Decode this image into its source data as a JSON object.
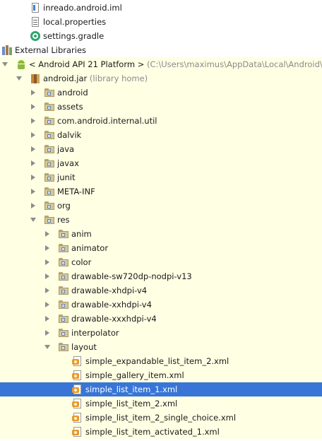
{
  "tree": {
    "rows": [
      {
        "label": "inreado.android.iml",
        "hint": "",
        "icon": "iml-file-icon",
        "arrow": "none",
        "depth": 2,
        "name": "tree-node-inreado-android-iml"
      },
      {
        "label": "local.properties",
        "hint": "",
        "icon": "properties-file-icon",
        "arrow": "none",
        "depth": 2,
        "name": "tree-node-local-properties"
      },
      {
        "label": "settings.gradle",
        "hint": "",
        "icon": "gradle-file-icon",
        "arrow": "none",
        "depth": 2,
        "name": "tree-node-settings-gradle"
      },
      {
        "label": "External Libraries",
        "hint": "",
        "icon": "external-libraries-icon",
        "arrow": "expanded",
        "depth": 0,
        "name": "tree-node-external-libraries"
      },
      {
        "label": "< Android API 21 Platform >",
        "hint": " (C:\\Users\\maximus\\AppData\\Local\\Android\\sdk)",
        "icon": "android-platform-icon",
        "arrow": "expanded",
        "depth": 1,
        "name": "tree-node-android-api-21-platform"
      },
      {
        "label": "android.jar",
        "hint": " (library home)",
        "icon": "jar-icon",
        "arrow": "expanded",
        "depth": 2,
        "name": "tree-node-android-jar"
      },
      {
        "label": "android",
        "hint": "",
        "icon": "package-folder-icon",
        "arrow": "collapsed",
        "depth": 3,
        "name": "tree-node-android"
      },
      {
        "label": "assets",
        "hint": "",
        "icon": "package-folder-icon",
        "arrow": "collapsed",
        "depth": 3,
        "name": "tree-node-assets"
      },
      {
        "label": "com.android.internal.util",
        "hint": "",
        "icon": "package-folder-icon",
        "arrow": "collapsed",
        "depth": 3,
        "name": "tree-node-com-android-internal-util"
      },
      {
        "label": "dalvik",
        "hint": "",
        "icon": "package-folder-icon",
        "arrow": "collapsed",
        "depth": 3,
        "name": "tree-node-dalvik"
      },
      {
        "label": "java",
        "hint": "",
        "icon": "package-folder-icon",
        "arrow": "collapsed",
        "depth": 3,
        "name": "tree-node-java"
      },
      {
        "label": "javax",
        "hint": "",
        "icon": "package-folder-icon",
        "arrow": "collapsed",
        "depth": 3,
        "name": "tree-node-javax"
      },
      {
        "label": "junit",
        "hint": "",
        "icon": "package-folder-icon",
        "arrow": "collapsed",
        "depth": 3,
        "name": "tree-node-junit"
      },
      {
        "label": "META-INF",
        "hint": "",
        "icon": "package-folder-icon",
        "arrow": "collapsed",
        "depth": 3,
        "name": "tree-node-meta-inf"
      },
      {
        "label": "org",
        "hint": "",
        "icon": "package-folder-icon",
        "arrow": "collapsed",
        "depth": 3,
        "name": "tree-node-org"
      },
      {
        "label": "res",
        "hint": "",
        "icon": "package-folder-icon",
        "arrow": "expanded",
        "depth": 3,
        "name": "tree-node-res"
      },
      {
        "label": "anim",
        "hint": "",
        "icon": "package-folder-icon",
        "arrow": "collapsed",
        "depth": 4,
        "name": "tree-node-anim"
      },
      {
        "label": "animator",
        "hint": "",
        "icon": "package-folder-icon",
        "arrow": "collapsed",
        "depth": 4,
        "name": "tree-node-animator"
      },
      {
        "label": "color",
        "hint": "",
        "icon": "package-folder-icon",
        "arrow": "collapsed",
        "depth": 4,
        "name": "tree-node-color"
      },
      {
        "label": "drawable-sw720dp-nodpi-v13",
        "hint": "",
        "icon": "package-folder-icon",
        "arrow": "collapsed",
        "depth": 4,
        "name": "tree-node-drawable-sw720dp-nodpi-v13"
      },
      {
        "label": "drawable-xhdpi-v4",
        "hint": "",
        "icon": "package-folder-icon",
        "arrow": "collapsed",
        "depth": 4,
        "name": "tree-node-drawable-xhdpi-v4"
      },
      {
        "label": "drawable-xxhdpi-v4",
        "hint": "",
        "icon": "package-folder-icon",
        "arrow": "collapsed",
        "depth": 4,
        "name": "tree-node-drawable-xxhdpi-v4"
      },
      {
        "label": "drawable-xxxhdpi-v4",
        "hint": "",
        "icon": "package-folder-icon",
        "arrow": "collapsed",
        "depth": 4,
        "name": "tree-node-drawable-xxxhdpi-v4"
      },
      {
        "label": "interpolator",
        "hint": "",
        "icon": "package-folder-icon",
        "arrow": "collapsed",
        "depth": 4,
        "name": "tree-node-interpolator"
      },
      {
        "label": "layout",
        "hint": "",
        "icon": "package-folder-icon",
        "arrow": "expanded",
        "depth": 4,
        "name": "tree-node-layout"
      },
      {
        "label": "simple_expandable_list_item_2.xml",
        "hint": "",
        "icon": "xml-file-icon",
        "arrow": "none",
        "depth": 5,
        "name": "tree-node-simple-expandable-list-item-2-xml"
      },
      {
        "label": "simple_gallery_item.xml",
        "hint": "",
        "icon": "xml-file-icon",
        "arrow": "none",
        "depth": 5,
        "name": "tree-node-simple-gallery-item-xml"
      },
      {
        "label": "simple_list_item_1.xml",
        "hint": "",
        "icon": "xml-file-icon",
        "arrow": "none",
        "depth": 5,
        "name": "tree-node-simple-list-item-1-xml",
        "selected": true
      },
      {
        "label": "simple_list_item_2.xml",
        "hint": "",
        "icon": "xml-file-icon",
        "arrow": "none",
        "depth": 5,
        "name": "tree-node-simple-list-item-2-xml"
      },
      {
        "label": "simple_list_item_2_single_choice.xml",
        "hint": "",
        "icon": "xml-file-icon",
        "arrow": "none",
        "depth": 5,
        "name": "tree-node-simple-list-item-2-single-choice-xml"
      },
      {
        "label": "simple_list_item_activated_1.xml",
        "hint": "",
        "icon": "xml-file-icon",
        "arrow": "none",
        "depth": 5,
        "name": "tree-node-simple-list-item-activated-1-xml"
      }
    ]
  },
  "colors": {
    "selection": "#3875d7",
    "library_background": "#ffffe4",
    "hint_text": "#8a8a8a"
  }
}
